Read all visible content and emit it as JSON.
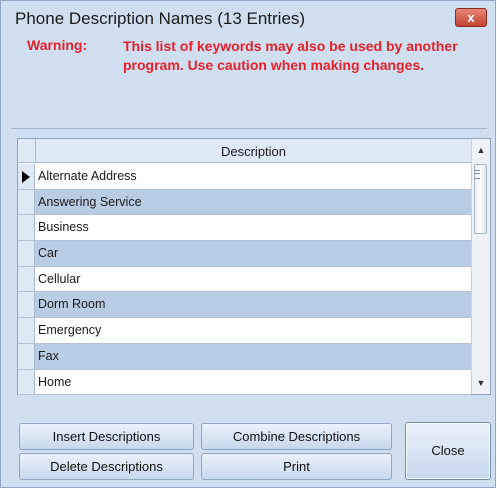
{
  "window": {
    "title": "Phone Description Names (13 Entries)",
    "close_glyph": "x"
  },
  "warning": {
    "label": "Warning:",
    "text": "This list of keywords may also be used by another program. Use caution when making changes."
  },
  "grid": {
    "column_header": "Description",
    "rows": [
      "Alternate Address",
      "Answering Service",
      "Business",
      "Car",
      "Cellular",
      "Dorm Room",
      "Emergency",
      "Fax",
      "Home"
    ],
    "current_row_index": 0,
    "scroll_up_glyph": "▲",
    "scroll_down_glyph": "▼"
  },
  "buttons": {
    "insert": "Insert Descriptions",
    "delete": "Delete Descriptions",
    "combine": "Combine Descriptions",
    "print": "Print",
    "close": "Close"
  },
  "colors": {
    "warning": "#e8202a",
    "row_alt": "#b8cde3",
    "dialog_bg": "#cfdff0"
  }
}
